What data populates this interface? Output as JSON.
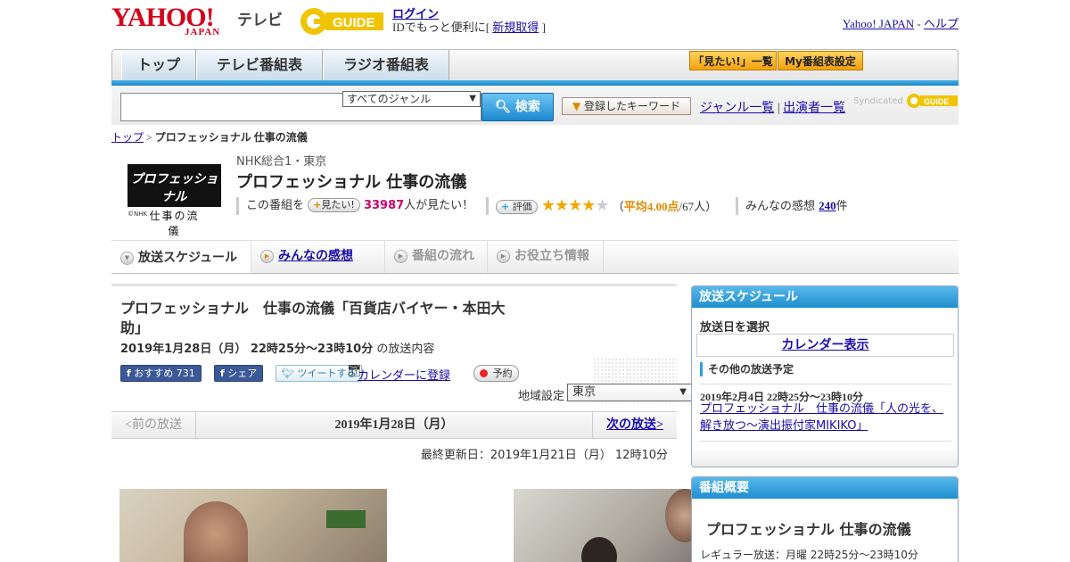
{
  "header": {
    "logo_text": "YAHOO!",
    "logo_sub": "JAPAN",
    "service_name": "テレビ",
    "gguide_logo": "G-GUIDE",
    "login_link": "ログイン",
    "login_sub_prefix": "IDでもっと便利に[",
    "signup_link": "新規取得",
    "login_sub_suffix": "]",
    "yahoo_japan_link": "Yahoo! JAPAN",
    "sep": "-",
    "help_link": "ヘルプ"
  },
  "nav": {
    "tabs": [
      "トップ",
      "テレビ番組表",
      "ラジオ番組表"
    ],
    "mitai_list": "「見たい!」一覧",
    "my_schedule": "My番組表設定"
  },
  "search": {
    "placeholder": "",
    "genre_selected": "すべてのジャンル",
    "search_button": "検索",
    "keyword_button": "登録したキーワード",
    "genre_list_link": "ジャンル一覧",
    "divider": "|",
    "cast_list_link": "出演者一覧",
    "syndicated": "Syndicated"
  },
  "breadcrumb": {
    "top": "トップ",
    "sep": ">",
    "current": "プロフェッショナル 仕事の流儀"
  },
  "program": {
    "logo_line1": "プロフェッショナル",
    "logo_line2": "仕事の流儀",
    "logo_credit": "©NHK",
    "channel": "NHK総合1・東京",
    "title": "プロフェッショナル 仕事の流儀",
    "mitai_prefix": "この番組を",
    "mitai_button": "見たい!",
    "mitai_count": "33987",
    "mitai_suffix": "人が見たい！",
    "rating_button": "評価",
    "rating_stars": 4,
    "rating_open": "（",
    "rating_avg": "平均4.00点",
    "rating_count": "/67人）",
    "review_prefix": "みんなの感想",
    "review_count": "240",
    "review_suffix": "件"
  },
  "tabs": [
    "放送スケジュール",
    "みんなの感想",
    "番組の流れ",
    "お役立ち情報"
  ],
  "episode": {
    "title": "プロフェッショナル　仕事の流儀「百貨店バイヤー・本田大助」",
    "date_time": "2019年1月28日（月） 22時25分～23時10分",
    "date_suffix": "の放送内容",
    "fb_recommend": "おすすめ",
    "fb_count": "731",
    "fb_share": "シェア",
    "tweet": "ツイートする",
    "calendar_register": "カレンダーに登録",
    "reserve": "予約",
    "region_label": "地域設定",
    "region_selected": "東京"
  },
  "pager": {
    "prev": "<前の放送",
    "current": "2019年1月28日（月）",
    "next": "次の放送>"
  },
  "updated": "最終更新日：2019年1月21日（月） 12時10分",
  "sidebar": {
    "schedule_header": "放送スケジュール",
    "select_date": "放送日を選択",
    "calendar_button": "カレンダー表示",
    "other_schedule": "その他の放送予定",
    "next_date": "2019年2月4日  22時25分～23時10分",
    "next_title": "プロフェッショナル　仕事の流儀「人の光を、解き放つ～演出振付家MIKIKO」",
    "overview_header": "番組概要",
    "overview_title": "プロフェッショナル 仕事の流儀",
    "regular_broadcast": "レギュラー放送：月曜 22時25分～23時10分"
  },
  "colors": {
    "brand_red": "#d4001a",
    "accent_blue": "#1f8fcf",
    "highlight_orange": "#e08a00",
    "mitai_pink": "#d0006f"
  }
}
